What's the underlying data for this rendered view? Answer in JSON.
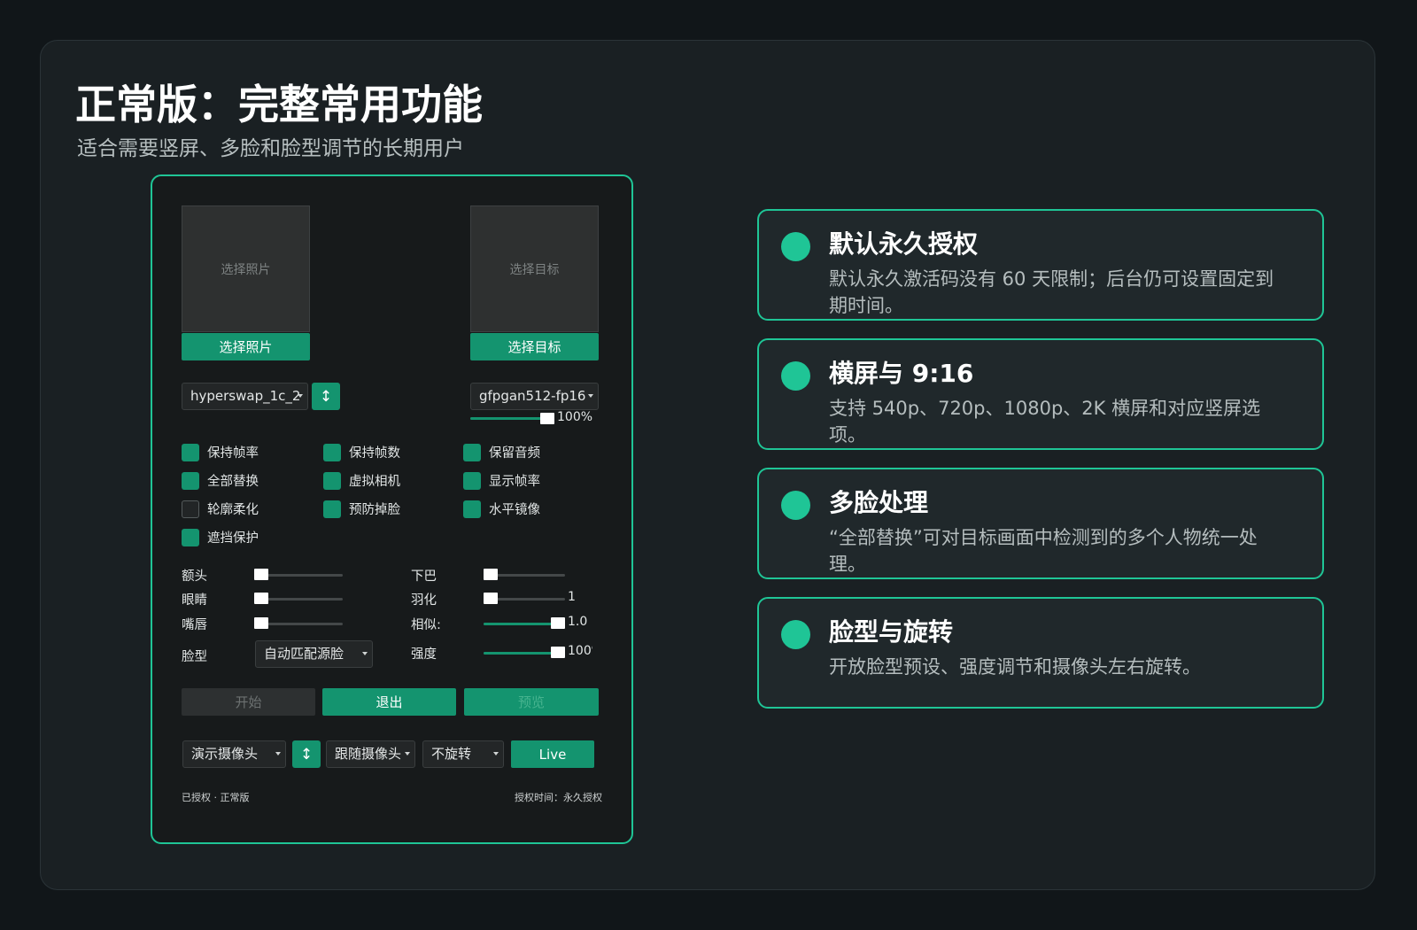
{
  "header": {
    "title": "正常版：完整常用功能",
    "subtitle": "适合需要竖屏、多脸和脸型调节的长期用户"
  },
  "app": {
    "source": {
      "placeholder": "选择照片",
      "button": "选择照片"
    },
    "target": {
      "placeholder": "选择目标",
      "button": "选择目标"
    },
    "model_select": "hyperswap_1c_2",
    "swap_icon": "↕",
    "enhancer_select": "gfpgan512-fp16",
    "enhancer_strength": "100%",
    "enhancer_strength_value": 100,
    "checkboxes": [
      {
        "label": "保持帧率",
        "checked": true
      },
      {
        "label": "保持帧数",
        "checked": true
      },
      {
        "label": "保留音频",
        "checked": true
      },
      {
        "label": "全部替换",
        "checked": true
      },
      {
        "label": "虚拟相机",
        "checked": true
      },
      {
        "label": "显示帧率",
        "checked": true
      },
      {
        "label": "轮廓柔化",
        "checked": false
      },
      {
        "label": "预防掉脸",
        "checked": true
      },
      {
        "label": "水平镜像",
        "checked": true
      },
      {
        "label": "遮挡保护",
        "checked": true
      }
    ],
    "sliders_left": [
      {
        "label": "额头",
        "value": 0
      },
      {
        "label": "眼睛",
        "value": 0
      },
      {
        "label": "嘴唇",
        "value": 0
      }
    ],
    "face_shape": {
      "label": "脸型",
      "value": "自动匹配源脸"
    },
    "sliders_right": [
      {
        "label": "下巴",
        "value": 0,
        "value_text": ""
      },
      {
        "label": "羽化",
        "value": 0,
        "value_text": "1"
      },
      {
        "label": "相似:",
        "value": 1.0,
        "value_text": "1.0"
      },
      {
        "label": "强度",
        "value": 1.0,
        "value_text": "100%"
      }
    ],
    "actions": {
      "start": "开始",
      "exit": "退出",
      "preview": "预览"
    },
    "bottom": {
      "camera": "演示摄像头",
      "swap_icon": "↕",
      "follow": "跟随摄像头",
      "rotate": "不旋转",
      "live": "Live"
    },
    "footer": {
      "left": "已授权 · 正常版",
      "right": "授权时间：永久授权"
    }
  },
  "features": [
    {
      "title": "默认永久授权",
      "desc": "默认永久激活码没有 60 天限制；后台仍可设置固定到期时间。"
    },
    {
      "title": "横屏与 9:16",
      "desc": "支持 540p、720p、1080p、2K 横屏和对应竖屏选项。"
    },
    {
      "title": "多脸处理",
      "desc": "“全部替换”可对目标画面中检测到的多个人物统一处理。"
    },
    {
      "title": "脸型与旋转",
      "desc": "开放脸型预设、强度调节和摄像头左右旋转。"
    }
  ],
  "colors": {
    "accent": "#1fc596",
    "button": "#14946f",
    "background": "#111619",
    "card": "#1a2023"
  }
}
